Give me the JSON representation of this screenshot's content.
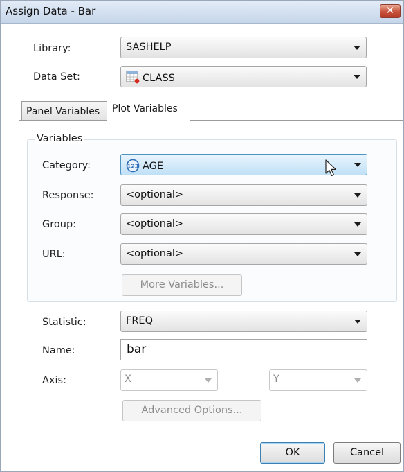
{
  "window": {
    "title": "Assign Data - Bar",
    "close_glyph": "✕"
  },
  "library": {
    "label": "Library:",
    "value": "SASHELP"
  },
  "dataset": {
    "label": "Data Set:",
    "value": "CLASS",
    "icon": "table-icon"
  },
  "tabs": [
    {
      "label": "Panel Variables",
      "selected": false
    },
    {
      "label": "Plot Variables",
      "selected": true
    }
  ],
  "variables": {
    "legend": "Variables",
    "category": {
      "label": "Category:",
      "value": "AGE",
      "icon": "numeric-123-icon"
    },
    "response": {
      "label": "Response:",
      "value": "<optional>"
    },
    "group": {
      "label": "Group:",
      "value": "<optional>"
    },
    "url": {
      "label": "URL:",
      "value": "<optional>"
    },
    "more_button": "More Variables..."
  },
  "statistic": {
    "label": "Statistic:",
    "value": "FREQ"
  },
  "name": {
    "label": "Name:",
    "value": "bar"
  },
  "axis": {
    "label": "Axis:",
    "x_value": "X",
    "y_value": "Y"
  },
  "advanced_button": "Advanced Options...",
  "footer": {
    "ok": "OK",
    "cancel": "Cancel"
  },
  "colors": {
    "highlight": "#bfe0f6",
    "close": "#c7533d"
  }
}
